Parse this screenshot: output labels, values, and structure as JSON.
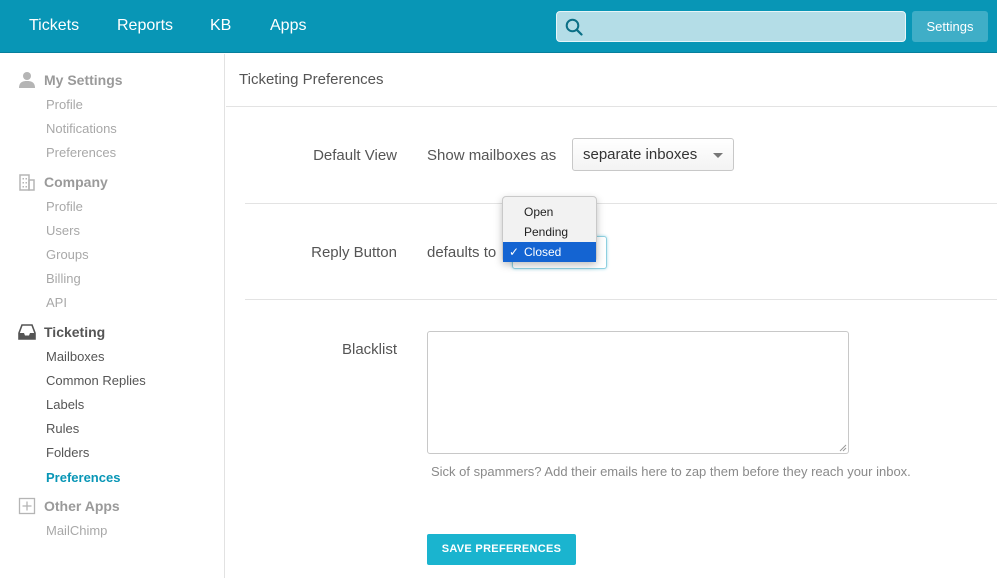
{
  "nav": {
    "items": [
      "Tickets",
      "Reports",
      "KB",
      "Apps"
    ],
    "search_placeholder": "",
    "settings_label": "Settings"
  },
  "sidebar": {
    "my_settings": {
      "title": "My Settings",
      "items": [
        "Profile",
        "Notifications",
        "Preferences"
      ]
    },
    "company": {
      "title": "Company",
      "items": [
        "Profile",
        "Users",
        "Groups",
        "Billing",
        "API"
      ]
    },
    "ticketing": {
      "title": "Ticketing",
      "items": [
        "Mailboxes",
        "Common Replies",
        "Labels",
        "Rules",
        "Folders",
        "Preferences"
      ],
      "current": "Preferences"
    },
    "other_apps": {
      "title": "Other Apps",
      "items": [
        "MailChimp"
      ]
    }
  },
  "main": {
    "title": "Ticketing Preferences",
    "default_view": {
      "label": "Default View",
      "prefix": "Show mailboxes as",
      "value": "separate inboxes"
    },
    "reply_button": {
      "label": "Reply Button",
      "prefix": "defaults to",
      "options": [
        "Open",
        "Pending",
        "Closed"
      ],
      "selected": "Closed"
    },
    "blacklist": {
      "label": "Blacklist",
      "value": "",
      "hint": "Sick of spammers? Add their emails here to zap them before they reach your inbox."
    },
    "save_label": "SAVE PREFERENCES"
  },
  "colors": {
    "topbar": "#0896b6",
    "accent": "#1ab4cf",
    "selected_option": "#1464d2"
  }
}
